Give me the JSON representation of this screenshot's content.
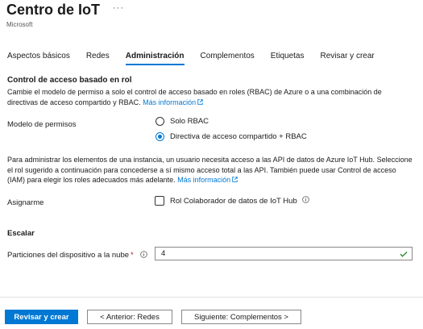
{
  "header": {
    "title": "Centro de IoT",
    "more_label": "···",
    "subtitle": "Microsoft"
  },
  "tabs": [
    {
      "label": "Aspectos básicos",
      "active": false
    },
    {
      "label": "Redes",
      "active": false
    },
    {
      "label": "Administración",
      "active": true
    },
    {
      "label": "Complementos",
      "active": false
    },
    {
      "label": "Etiquetas",
      "active": false
    },
    {
      "label": "Revisar y crear",
      "active": false
    }
  ],
  "rbac": {
    "heading": "Control de acceso basado en rol",
    "description": "Cambie el modelo de permiso a solo el control de acceso basado en roles (RBAC) de Azure o a una combinación de directivas de acceso compartido y RBAC.",
    "learn_more": "Más información",
    "permission_model_label": "Modelo de permisos",
    "options": [
      {
        "label": "Solo RBAC",
        "selected": false
      },
      {
        "label": "Directiva de acceso compartido + RBAC",
        "selected": true
      }
    ]
  },
  "assign": {
    "description": "Para administrar los elementos de una instancia, un usuario necesita acceso a las API de datos de Azure IoT Hub. Seleccione el rol sugerido a continuación para concederse a sí mismo acceso total a las API. También puede usar Control de acceso (IAM) para elegir los roles adecuados más adelante.",
    "learn_more": "Más información",
    "label": "Asignarme",
    "checkbox_label": "Rol Colaborador de datos de IoT Hub",
    "checked": false
  },
  "scale": {
    "heading": "Escalar",
    "partitions_label": "Particiones del dispositivo a la nube",
    "required_mark": "*",
    "partitions_value": "4"
  },
  "footer": {
    "review_create": "Revisar y crear",
    "previous": "< Anterior: Redes",
    "next": "Siguiente: Complementos >"
  },
  "colors": {
    "accent": "#0078d4",
    "required": "#a4262c",
    "valid": "#107c10"
  },
  "icons": {
    "more": "more-ellipsis-icon",
    "external_link": "external-link-icon",
    "info": "info-icon",
    "valid": "checkmark-icon"
  }
}
